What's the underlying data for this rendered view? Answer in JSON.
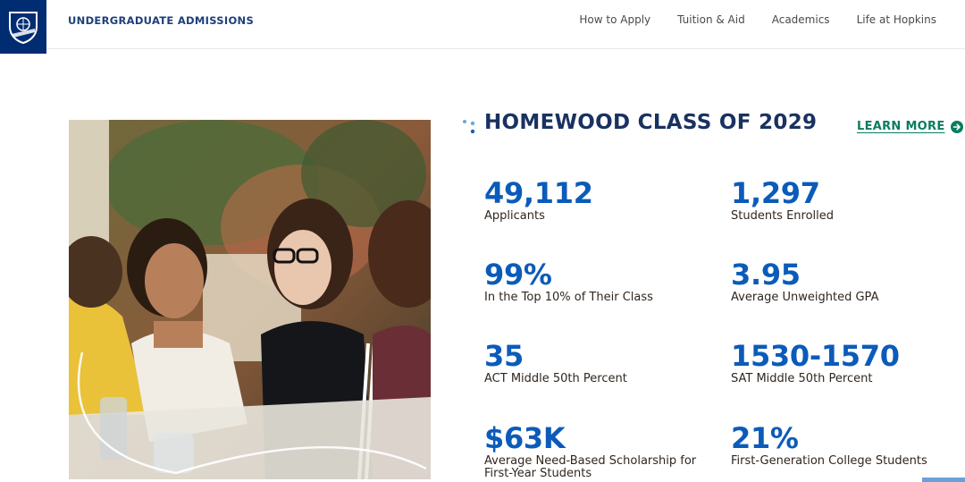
{
  "header": {
    "site_title": "UNDERGRADUATE ADMISSIONS",
    "nav": [
      {
        "label": "How to Apply"
      },
      {
        "label": "Tuition & Aid"
      },
      {
        "label": "Academics"
      },
      {
        "label": "Life at Hopkins"
      }
    ]
  },
  "colors": {
    "brand_navy": "#002d72",
    "stat_blue": "#0b5bba",
    "heading_navy": "#1a3260",
    "link_green": "#0b7c5f"
  },
  "section": {
    "title": "HOMEWOOD CLASS OF 2029",
    "learn_more": "LEARN MORE"
  },
  "stats": [
    {
      "value": "49,112",
      "label": "Applicants"
    },
    {
      "value": "1,297",
      "label": "Students Enrolled"
    },
    {
      "value": "99%",
      "label": "In the Top 10% of Their Class"
    },
    {
      "value": "3.95",
      "label": "Average Unweighted GPA"
    },
    {
      "value": "35",
      "label": "ACT Middle 50th Percent"
    },
    {
      "value": "1530-1570",
      "label": "SAT Middle 50th Percent"
    },
    {
      "value": "$63K",
      "label": "Average Need-Based Scholarship for First-Year Students"
    },
    {
      "value": "21%",
      "label": "First-Generation College Students"
    }
  ],
  "icons": {
    "logo": "university-shield-icon",
    "learn_more": "arrow-right-circle-icon"
  }
}
